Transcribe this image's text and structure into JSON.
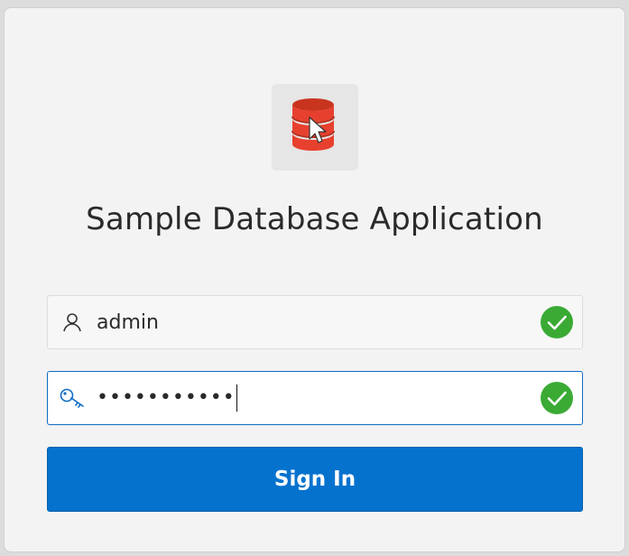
{
  "app": {
    "title": "Sample Database Application",
    "logo_icon": "database-cursor-icon",
    "logo_color": "#e8402e"
  },
  "login_form": {
    "username": {
      "value": "admin",
      "icon": "user-icon",
      "status_icon": "check-circle-icon",
      "status_color": "#3aaa35"
    },
    "password": {
      "masked_value": "•••••••••••",
      "icon": "key-icon",
      "status_icon": "check-circle-icon",
      "status_color": "#3aaa35",
      "focused": true
    },
    "submit_label": "Sign In",
    "accent_color": "#0572ce"
  }
}
